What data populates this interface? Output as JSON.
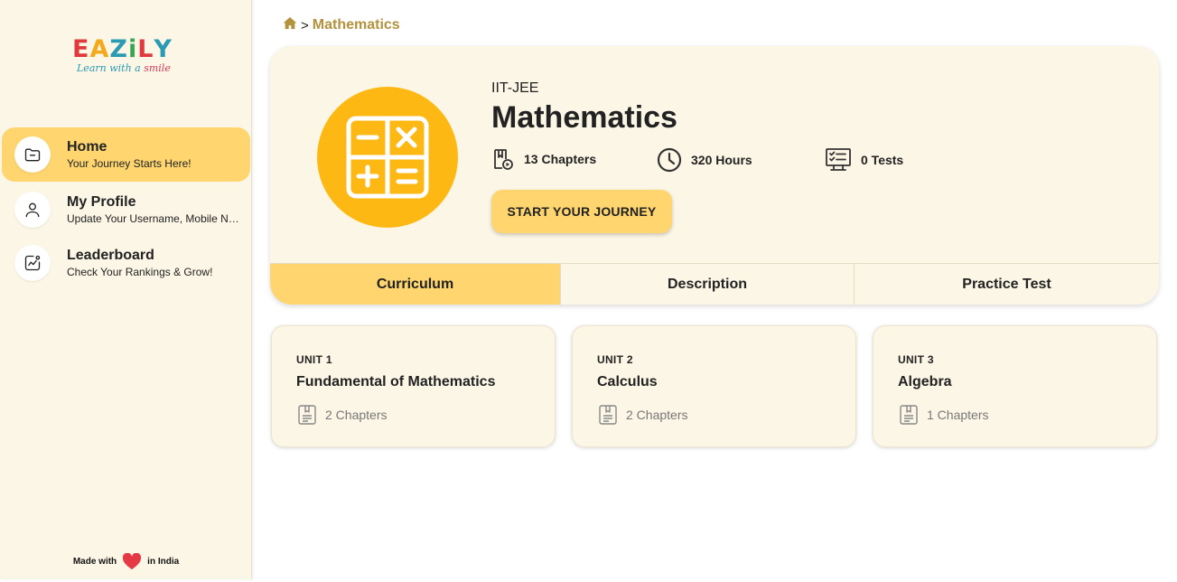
{
  "brand": {
    "logo_letters": [
      "E",
      "A",
      "Z",
      "i",
      "L",
      "Y"
    ],
    "logo_colors": [
      "#e03a3e",
      "#f4a91c",
      "#2a9bb3",
      "#3aa655",
      "#e03a3e",
      "#2a9bb3"
    ],
    "tagline_start": "Learn with a ",
    "tagline_end": "smile"
  },
  "sidebar": {
    "items": [
      {
        "title": "Home",
        "subtitle": "Your Journey Starts Here!",
        "icon": "folder-icon",
        "active": true
      },
      {
        "title": "My Profile",
        "subtitle": "Update Your Username, Mobile Number & Password",
        "icon": "user-icon",
        "active": false
      },
      {
        "title": "Leaderboard",
        "subtitle": "Check Your Rankings & Grow!",
        "icon": "chart-icon",
        "active": false
      }
    ],
    "footer": {
      "made_with": "Made with",
      "in_india": "in India",
      "heart_color": "#e53945"
    }
  },
  "breadcrumb": {
    "separator": ">",
    "current": "Mathematics"
  },
  "course": {
    "category": "IIT-JEE",
    "title": "Mathematics",
    "icon": "calculator-icon",
    "icon_bg": "#fdb813",
    "stats": {
      "chapters": "13 Chapters",
      "hours": "320 Hours",
      "tests": "0 Tests"
    },
    "start_button": "START YOUR JOURNEY"
  },
  "tabs": [
    {
      "label": "Curriculum",
      "active": true
    },
    {
      "label": "Description",
      "active": false
    },
    {
      "label": "Practice Test",
      "active": false
    }
  ],
  "units": [
    {
      "label": "UNIT 1",
      "title": "Fundamental of Mathematics",
      "chapters": "2 Chapters"
    },
    {
      "label": "UNIT 2",
      "title": "Calculus",
      "chapters": "2 Chapters"
    },
    {
      "label": "UNIT 3",
      "title": "Algebra",
      "chapters": "1 Chapters"
    }
  ],
  "colors": {
    "accent": "#fed56f",
    "panel": "#fcf6e6",
    "breadcrumb_link": "#b3923d"
  }
}
